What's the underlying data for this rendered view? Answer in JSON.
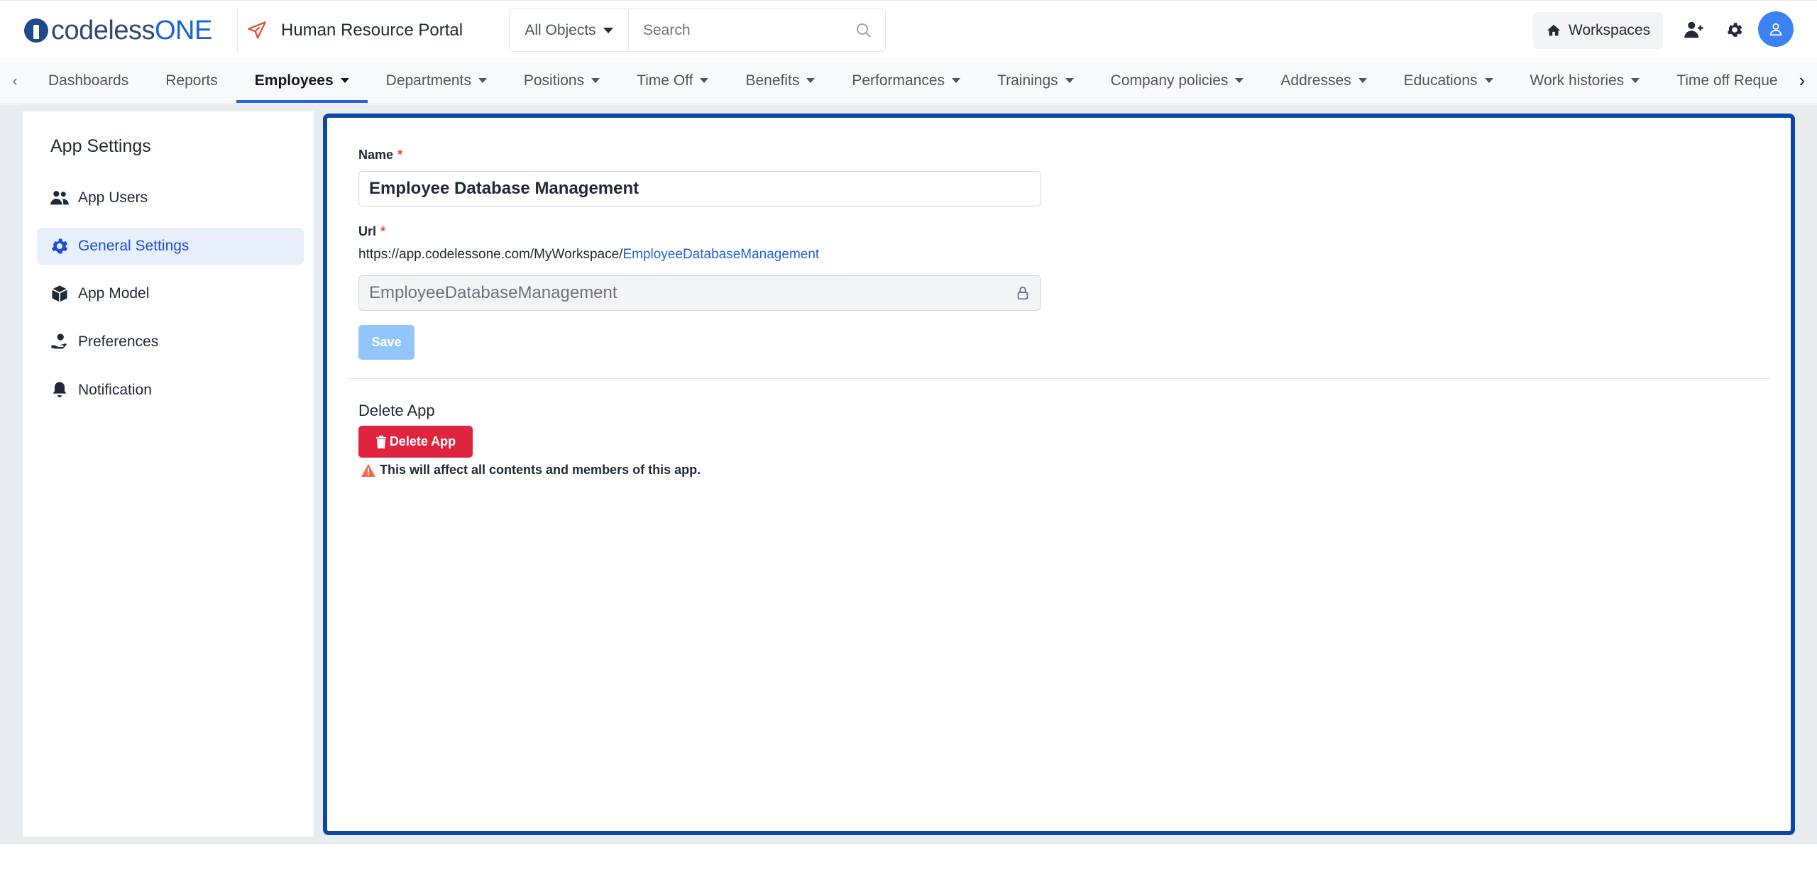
{
  "brand": {
    "name_part1": "codeless",
    "name_part2": "ONE"
  },
  "app": {
    "title": "Human Resource Portal"
  },
  "search": {
    "object_filter": "All Objects",
    "placeholder": "Search"
  },
  "topbar": {
    "workspaces_label": "Workspaces"
  },
  "nav": {
    "items": [
      {
        "label": "Dashboards",
        "dropdown": false
      },
      {
        "label": "Reports",
        "dropdown": false
      },
      {
        "label": "Employees",
        "dropdown": true,
        "active": true
      },
      {
        "label": "Departments",
        "dropdown": true
      },
      {
        "label": "Positions",
        "dropdown": true
      },
      {
        "label": "Time Off",
        "dropdown": true
      },
      {
        "label": "Benefits",
        "dropdown": true
      },
      {
        "label": "Performances",
        "dropdown": true
      },
      {
        "label": "Trainings",
        "dropdown": true
      },
      {
        "label": "Company policies",
        "dropdown": true
      },
      {
        "label": "Addresses",
        "dropdown": true
      },
      {
        "label": "Educations",
        "dropdown": true
      },
      {
        "label": "Work histories",
        "dropdown": true
      },
      {
        "label": "Time off Reque",
        "dropdown": false
      }
    ]
  },
  "sidebar": {
    "title": "App Settings",
    "items": [
      {
        "label": "App Users",
        "icon": "users-icon"
      },
      {
        "label": "General Settings",
        "icon": "gear-icon",
        "active": true
      },
      {
        "label": "App Model",
        "icon": "cube-icon"
      },
      {
        "label": "Preferences",
        "icon": "hand-user-icon"
      },
      {
        "label": "Notification",
        "icon": "bell-icon"
      }
    ]
  },
  "form": {
    "name_label": "Name",
    "name_value": "Employee Database Management",
    "url_label": "Url",
    "url_prefix": "https://app.codelessone.com/MyWorkspace/",
    "url_slug": "EmployeeDatabaseManagement",
    "slug_value": "EmployeeDatabaseManagement",
    "save_label": "Save",
    "required_mark": "*"
  },
  "danger": {
    "title": "Delete App",
    "button_label": "Delete App",
    "warning": "This will affect all contents and members of this app."
  },
  "colors": {
    "accent": "#2563eb",
    "panel_border": "#0b46a8",
    "danger": "#e0243f",
    "save_disabled": "#93c5fd"
  }
}
